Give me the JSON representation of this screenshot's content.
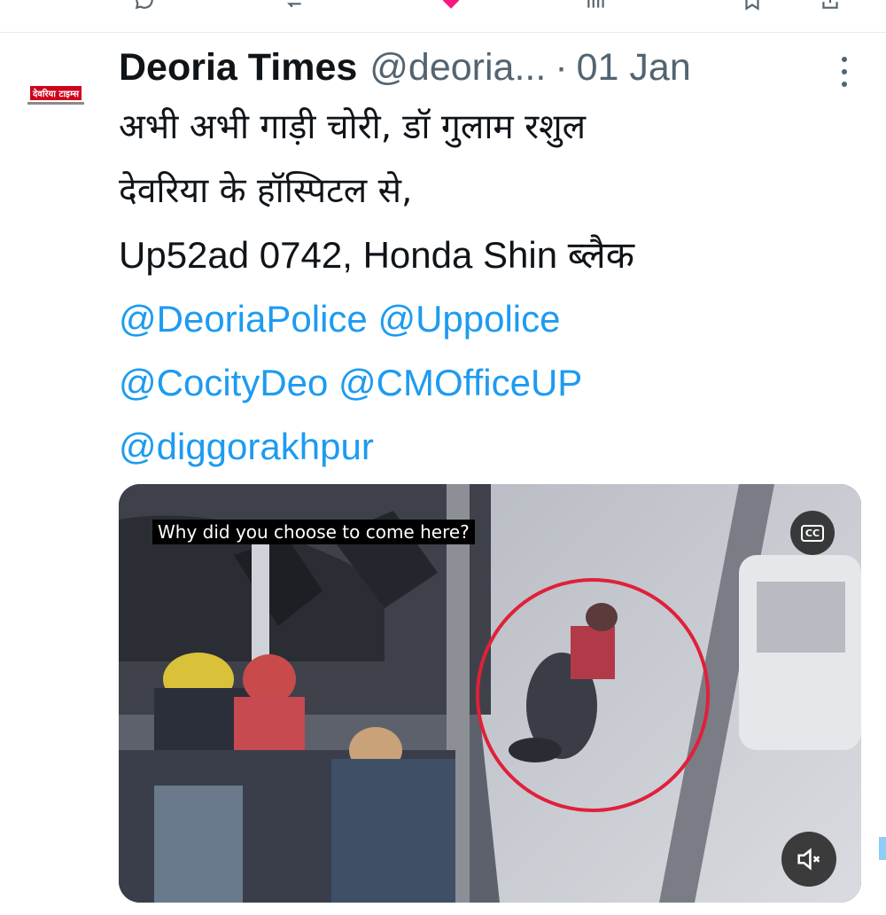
{
  "tweet": {
    "author_name": "Deoria Times",
    "handle": "@deoria...",
    "separator": "·",
    "date": "01 Jan",
    "avatar_text": "देवरिया टाइम्स",
    "lines": [
      "अभी अभी गाड़ी चोरी, डॉ गुलाम रशुल",
      "देवरिया के हॉस्पिटल से,",
      "Up52ad 0742,  Honda Shin ब्लैक"
    ],
    "mentions_line1": [
      "@DeoriaPolice",
      "@Uppolice"
    ],
    "mentions_line2": [
      "@CocityDeo",
      "@CMOfficeUP"
    ],
    "mentions_line3": [
      "@diggorakhpur"
    ]
  },
  "video": {
    "caption": "Why did you choose to come here?",
    "cc_label": "CC"
  },
  "colors": {
    "text": "#0f1419",
    "secondary": "#536471",
    "link": "#1d9bf0",
    "highlight_circle": "#e0203a"
  }
}
